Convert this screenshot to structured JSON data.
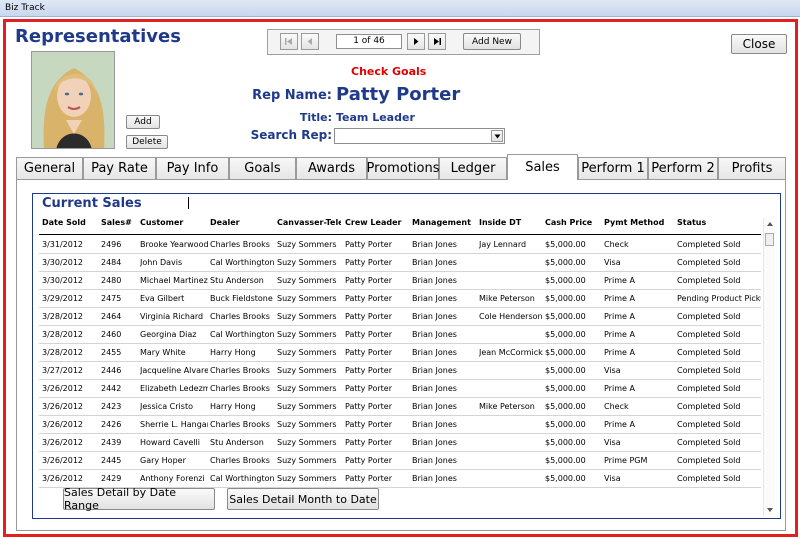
{
  "window": {
    "title": "Biz Track"
  },
  "page": {
    "title": "Representatives"
  },
  "photo": {
    "add_label": "Add",
    "delete_label": "Delete"
  },
  "navigator": {
    "record_text": "1 of 46",
    "add_new_label": "Add New"
  },
  "close_label": "Close",
  "check_goals_label": "Check Goals",
  "rep": {
    "name_label": "Rep Name:",
    "name_value": "Patty Porter",
    "title_label": "Title:",
    "title_value": "Team Leader",
    "search_label": "Search Rep:",
    "search_value": ""
  },
  "tabs": [
    {
      "label": "General"
    },
    {
      "label": "Pay Rate"
    },
    {
      "label": "Pay Info"
    },
    {
      "label": "Goals"
    },
    {
      "label": "Awards"
    },
    {
      "label": "Promotions"
    },
    {
      "label": "Ledger"
    },
    {
      "label": "Sales"
    },
    {
      "label": "Perform 1"
    },
    {
      "label": "Perform 2"
    },
    {
      "label": "Profits"
    }
  ],
  "active_tab": "Sales",
  "sales": {
    "title": "Current Sales",
    "columns": [
      "Date Sold",
      "Sales#",
      "Customer",
      "Dealer",
      "Canvasser-Tele",
      "Crew Leader",
      "Management",
      "Inside DT",
      "Cash Price",
      "Pymt Method",
      "Status"
    ],
    "rows": [
      [
        "3/31/2012",
        "2496",
        "Brooke Yearwood",
        "Charles Brooks",
        "Suzy Sommers",
        "Patty Porter",
        "Brian Jones",
        "Jay Lennard",
        "$5,000.00",
        "Check",
        "Completed Sold"
      ],
      [
        "3/30/2012",
        "2484",
        "John Davis",
        "Cal Worthington",
        "Suzy Sommers",
        "Patty Porter",
        "Brian Jones",
        "",
        "$5,000.00",
        "Visa",
        "Completed Sold"
      ],
      [
        "3/30/2012",
        "2480",
        "Michael Martinez",
        "Stu Anderson",
        "Suzy Sommers",
        "Patty Porter",
        "Brian Jones",
        "",
        "$5,000.00",
        "Prime A",
        "Completed Sold"
      ],
      [
        "3/29/2012",
        "2475",
        "Eva Gilbert",
        "Buck Fieldstone",
        "Suzy Sommers",
        "Patty Porter",
        "Brian Jones",
        "Mike Peterson",
        "$5,000.00",
        "Prime A",
        "Pending Product Pickup"
      ],
      [
        "3/28/2012",
        "2464",
        "Virginia Richard",
        "Charles Brooks",
        "Suzy Sommers",
        "Patty Porter",
        "Brian Jones",
        "Cole Henderson",
        "$5,000.00",
        "Prime A",
        "Completed Sold"
      ],
      [
        "3/28/2012",
        "2460",
        "Georgina Diaz",
        "Cal Worthington",
        "Suzy Sommers",
        "Patty Porter",
        "Brian Jones",
        "",
        "$5,000.00",
        "Prime A",
        "Completed Sold"
      ],
      [
        "3/28/2012",
        "2455",
        "Mary White",
        "Harry Hong",
        "Suzy Sommers",
        "Patty Porter",
        "Brian Jones",
        "Jean McCormick",
        "$5,000.00",
        "Prime A",
        "Completed Sold"
      ],
      [
        "3/27/2012",
        "2446",
        "Jacqueline Alvarez",
        "Charles Brooks",
        "Suzy Sommers",
        "Patty Porter",
        "Brian Jones",
        "",
        "$5,000.00",
        "Visa",
        "Completed Sold"
      ],
      [
        "3/26/2012",
        "2442",
        "Elizabeth Ledezma",
        "Charles Brooks",
        "Suzy Sommers",
        "Patty Porter",
        "Brian Jones",
        "",
        "$5,000.00",
        "Prime A",
        "Completed Sold"
      ],
      [
        "3/26/2012",
        "2423",
        "Jessica Cristo",
        "Harry Hong",
        "Suzy Sommers",
        "Patty Porter",
        "Brian Jones",
        "Mike Peterson",
        "$5,000.00",
        "Check",
        "Completed Sold"
      ],
      [
        "3/26/2012",
        "2426",
        "Sherrie L. Hangan",
        "Charles Brooks",
        "Suzy Sommers",
        "Patty Porter",
        "Brian Jones",
        "",
        "$5,000.00",
        "Prime A",
        "Completed Sold"
      ],
      [
        "3/26/2012",
        "2439",
        "Howard Cavelli",
        "Stu Anderson",
        "Suzy Sommers",
        "Patty Porter",
        "Brian Jones",
        "",
        "$5,000.00",
        "Visa",
        "Completed Sold"
      ],
      [
        "3/26/2012",
        "2445",
        "Gary Hoper",
        "Charles Brooks",
        "Suzy Sommers",
        "Patty Porter",
        "Brian Jones",
        "",
        "$5,000.00",
        "Prime PGM",
        "Completed Sold"
      ],
      [
        "3/26/2012",
        "2429",
        "Anthony Forenzi",
        "Cal Worthington",
        "Suzy Sommers",
        "Patty Porter",
        "Brian Jones",
        "",
        "$5,000.00",
        "Visa",
        "Completed Sold"
      ]
    ],
    "date_range_button": "Sales Detail by Date Range",
    "month_to_date_button": "Sales Detail Month to Date"
  },
  "colors": {
    "frame": "#e32020",
    "heading": "#1f3a8a",
    "alert": "#e00000"
  }
}
